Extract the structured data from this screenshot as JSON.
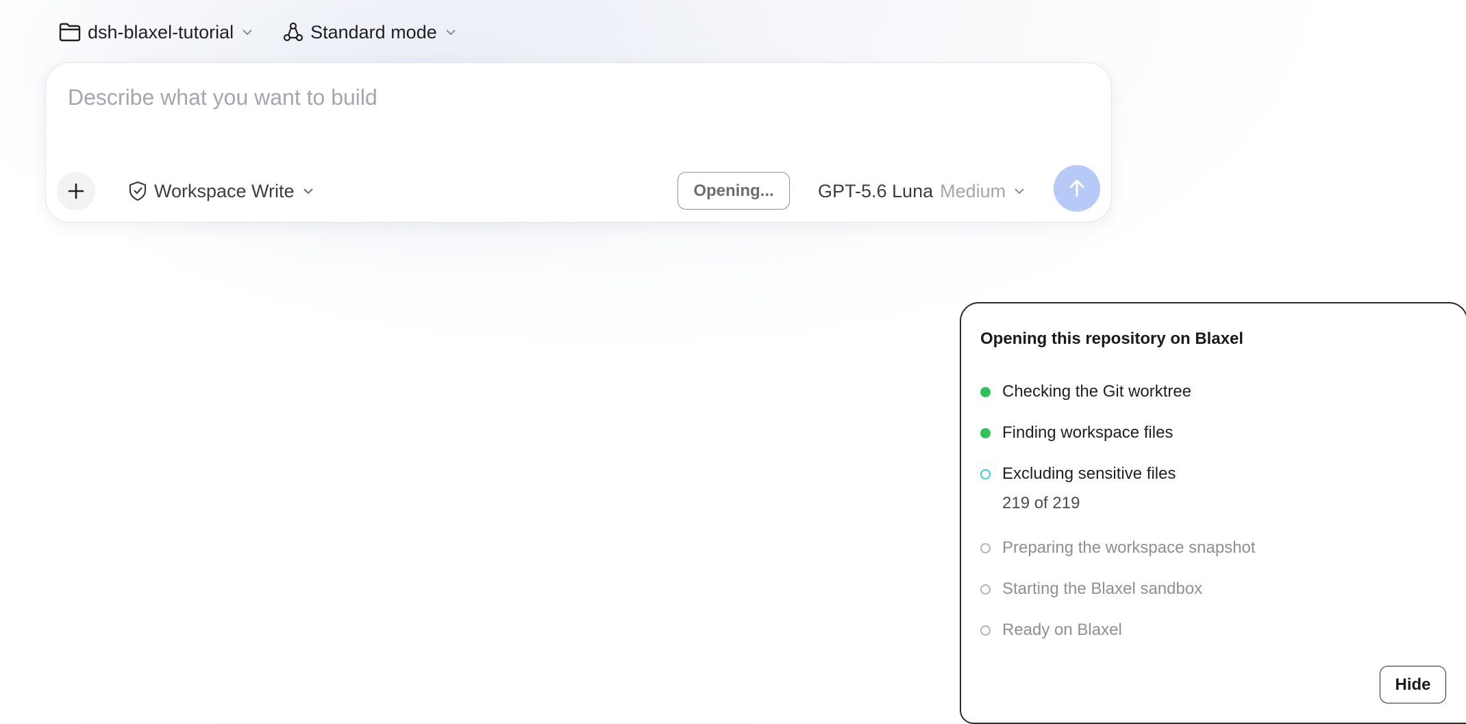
{
  "topbar": {
    "project": {
      "label": "dsh-blaxel-tutorial",
      "icon": "folder-icon"
    },
    "mode": {
      "label": "Standard mode",
      "icon": "nodes-icon"
    }
  },
  "composer": {
    "placeholder": "Describe what you want to build",
    "permission": {
      "label": "Workspace Write",
      "icon": "shield-check-icon"
    },
    "status_button": "Opening...",
    "model": {
      "name": "GPT-5.6 Luna",
      "effort": "Medium"
    },
    "send_icon": "arrow-up-icon",
    "add_icon": "plus-icon"
  },
  "progress_panel": {
    "title": "Opening this repository on Blaxel",
    "steps": [
      {
        "label": "Checking the Git worktree",
        "status": "done"
      },
      {
        "label": "Finding workspace files",
        "status": "done"
      },
      {
        "label": "Excluding sensitive files",
        "status": "active",
        "detail": "219 of 219"
      },
      {
        "label": "Preparing the workspace snapshot",
        "status": "pending"
      },
      {
        "label": "Starting the Blaxel sandbox",
        "status": "pending"
      },
      {
        "label": "Ready on Blaxel",
        "status": "pending"
      }
    ],
    "hide_label": "Hide"
  },
  "colors": {
    "done": "#2ec25a",
    "active": "#3ec6d6",
    "send_button": "#b7c9f6"
  }
}
